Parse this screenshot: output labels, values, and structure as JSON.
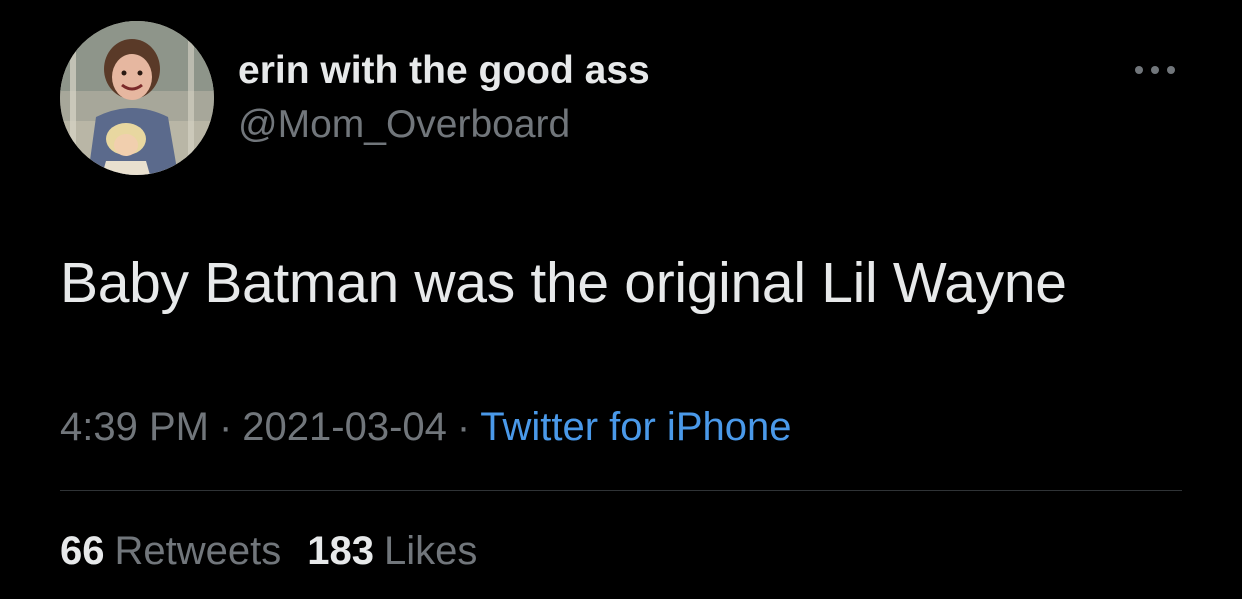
{
  "tweet": {
    "author": {
      "display_name": "erin with the good ass",
      "handle": "@Mom_Overboard"
    },
    "text": "Baby Batman was the original Lil Wayne",
    "time": "4:39 PM",
    "separator": "·",
    "date": "2021-03-04",
    "source": "Twitter for iPhone",
    "stats": {
      "retweets_count": "66",
      "retweets_label": "Retweets",
      "likes_count": "183",
      "likes_label": "Likes"
    },
    "more_icon": "more-horizontal-icon"
  },
  "colors": {
    "background": "#000000",
    "primary_text": "#e7e9ea",
    "secondary_text": "#71767b",
    "link": "#4a99e9",
    "divider": "#2f3336"
  }
}
